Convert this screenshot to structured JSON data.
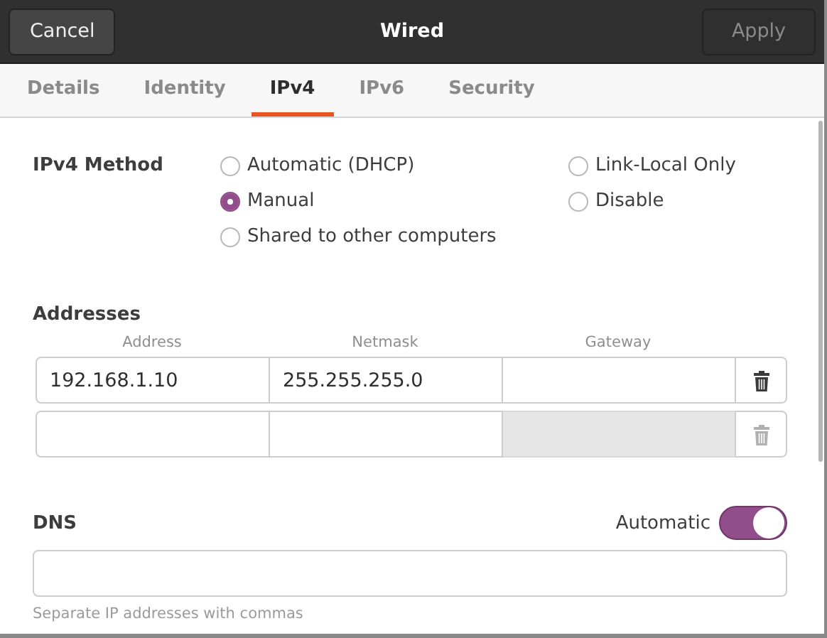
{
  "window": {
    "title": "Wired"
  },
  "header_buttons": [
    {
      "label": "Cancel",
      "disabled": false
    },
    {
      "label": "Apply",
      "disabled": true
    }
  ],
  "tabs": [
    {
      "label": "Details",
      "selected": false
    },
    {
      "label": "Identity",
      "selected": false
    },
    {
      "label": "IPv4",
      "selected": true
    },
    {
      "label": "IPv6",
      "selected": false
    },
    {
      "label": "Security",
      "selected": false
    }
  ],
  "method": {
    "label": "IPv4 Method",
    "options": [
      {
        "label": "Automatic (DHCP)",
        "selected": false
      },
      {
        "label": "Link-Local Only",
        "selected": false
      },
      {
        "label": "Manual",
        "selected": true
      },
      {
        "label": "Disable",
        "selected": false
      },
      {
        "label": "Shared to other computers",
        "selected": false
      }
    ]
  },
  "addresses": {
    "heading": "Addresses",
    "columns": [
      "Address",
      "Netmask",
      "Gateway"
    ],
    "rows": [
      {
        "cells": [
          {
            "value": "192.168.1.10",
            "disabled": false
          },
          {
            "value": "255.255.255.0",
            "disabled": false
          },
          {
            "disabled": false
          }
        ],
        "delete_disabled": false
      },
      {
        "cells": [
          {
            "disabled": false
          },
          {
            "disabled": false
          },
          {
            "disabled": true
          }
        ],
        "delete_disabled": true
      }
    ]
  },
  "dns": {
    "heading": "DNS",
    "toggle_label": "Automatic",
    "on": true,
    "hint": "Separate IP addresses with commas"
  }
}
